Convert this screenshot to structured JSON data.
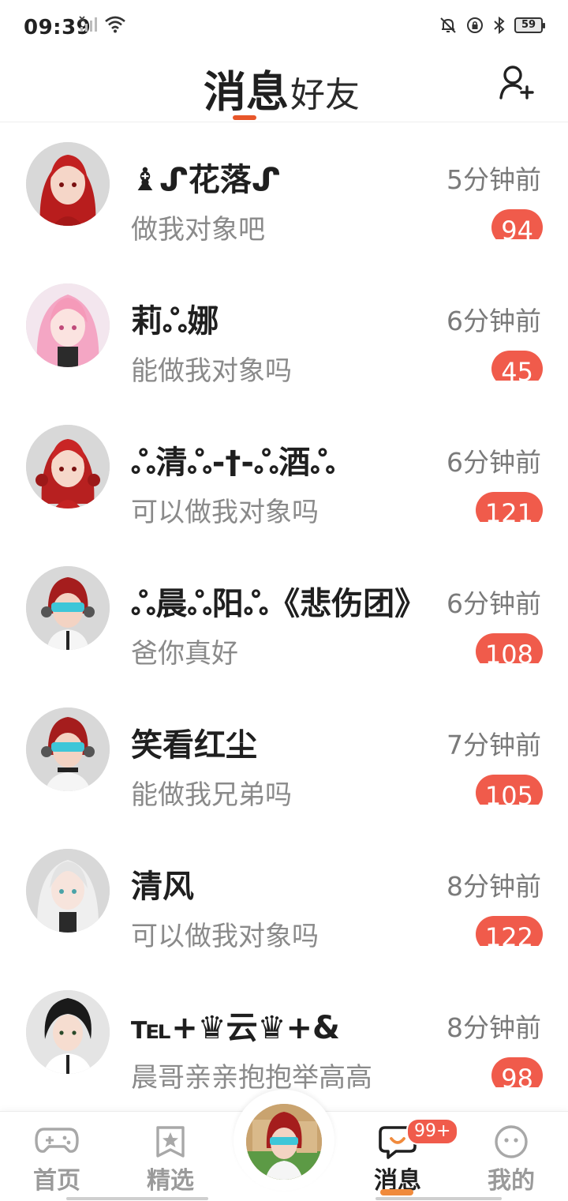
{
  "status_bar": {
    "time": "09:39",
    "battery": "59",
    "icons": [
      "signal-off-icon",
      "wifi-icon",
      "bell-muted-icon",
      "lock-rotation-icon",
      "bluetooth-icon",
      "battery-icon"
    ]
  },
  "header": {
    "active_tab": "消息",
    "inactive_tab": "好友",
    "add_friend_icon": "add-friend-icon"
  },
  "colors": {
    "accent": "#e8562a",
    "badge": "#f05b4b",
    "muted_text": "#8a8a8a"
  },
  "conversations": [
    {
      "name": "♝ᔑ花落ᔑ",
      "preview": "做我对象吧",
      "time": "5分钟前",
      "unread": "94"
    },
    {
      "name": "莉ஃ娜",
      "preview": "能做我对象吗",
      "time": "6分钟前",
      "unread": "45"
    },
    {
      "name": "ஃ清ஃ-†-ஃ酒ஃ",
      "preview": "可以做我对象吗",
      "time": "6分钟前",
      "unread": "121"
    },
    {
      "name": "ஃ晨ஃ阳ஃ《悲伤团》",
      "preview": "爸你真好",
      "time": "6分钟前",
      "unread": "108"
    },
    {
      "name": "笑看红尘",
      "preview": "能做我兄弟吗",
      "time": "7分钟前",
      "unread": "105"
    },
    {
      "name": "清风",
      "preview": "可以做我对象吗",
      "time": "8分钟前",
      "unread": "122"
    },
    {
      "name": "℡+♛云♛+&",
      "preview": "晨哥亲亲抱抱举高高",
      "time": "8分钟前",
      "unread": "98"
    }
  ],
  "bottom_nav": {
    "items": [
      {
        "label": "首页",
        "icon": "gamepad-icon"
      },
      {
        "label": "精选",
        "icon": "star-bookmark-icon"
      },
      {
        "label": "",
        "icon": "center-avatar"
      },
      {
        "label": "消息",
        "icon": "chat-bubble-icon",
        "badge": "99+"
      },
      {
        "label": "我的",
        "icon": "face-icon"
      }
    ]
  }
}
